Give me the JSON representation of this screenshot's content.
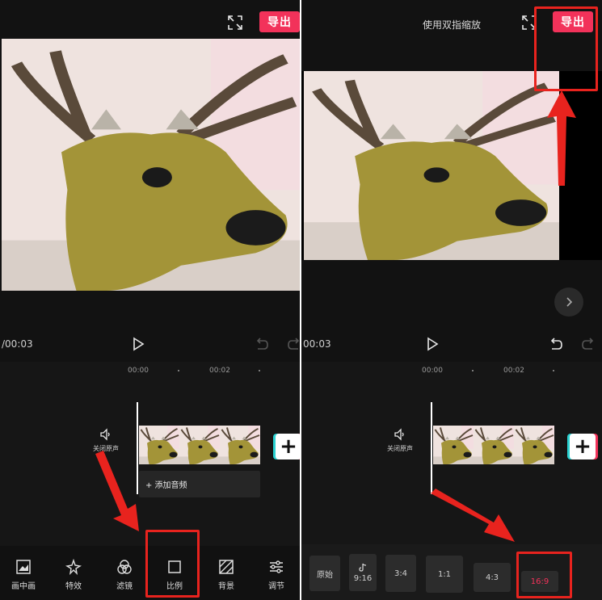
{
  "left": {
    "export_label": "导出",
    "time_current": "/00:03",
    "ruler_marks": [
      "00:00",
      "00:02"
    ],
    "mute_label": "关闭原声",
    "add_audio_label": "+ 添加音频",
    "tools": [
      {
        "label": "画中画",
        "icon": "picture-in-picture-icon"
      },
      {
        "label": "特效",
        "icon": "sparkle-icon"
      },
      {
        "label": "滤镜",
        "icon": "filter-circles-icon"
      },
      {
        "label": "比例",
        "icon": "ratio-square-icon"
      },
      {
        "label": "背景",
        "icon": "background-hatch-icon"
      },
      {
        "label": "调节",
        "icon": "adjust-sliders-icon"
      }
    ]
  },
  "right": {
    "header_title": "使用双指缩放",
    "export_label": "导出",
    "time_current": "00:03",
    "ruler_marks": [
      "00:00",
      "00:02"
    ],
    "mute_label": "关闭原声",
    "ratios": [
      {
        "label": "原始"
      },
      {
        "label": "9:16",
        "icon": "tiktok-icon"
      },
      {
        "label": "3:4"
      },
      {
        "label": "1:1"
      },
      {
        "label": "4:3"
      },
      {
        "label": "16:9",
        "selected": true
      }
    ]
  },
  "colors": {
    "accent": "#f2325a",
    "highlight": "#e8231e",
    "background": "#121212"
  }
}
